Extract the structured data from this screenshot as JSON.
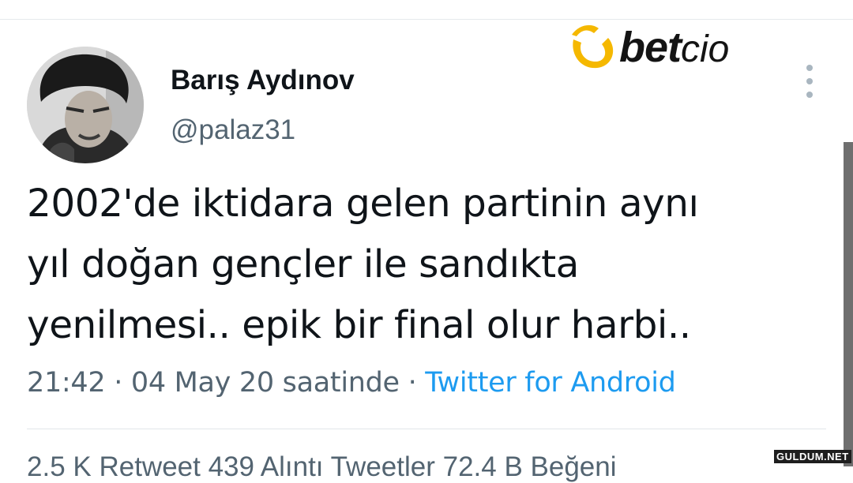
{
  "user": {
    "display_name": "Barış Aydınov",
    "handle": "@palaz31"
  },
  "brand": {
    "name_bold": "bet",
    "name_light": "cio",
    "icon": "betcio-logo-icon",
    "accent_color": "#f5b800"
  },
  "tweet": {
    "lines": [
      "2002'de iktidara gelen partinin aynı",
      "yıl doğan gençler ile sandıkta",
      "yenilmesi.. epik bir final olur harbi.."
    ],
    "time": "21:42",
    "separator": " · ",
    "date": "04 May 20 saatinde",
    "source": "Twitter for Android"
  },
  "stats": {
    "text": "2.5 K Retweet  439 Alıntı Tweetler  72.4 B Beğeni"
  },
  "watermark": "GULDUM.NET",
  "icons": {
    "more": "more-vertical-icon",
    "avatar": "avatar"
  },
  "colors": {
    "text_primary": "#0f1419",
    "text_secondary": "#536471",
    "link": "#1d9bf0"
  }
}
